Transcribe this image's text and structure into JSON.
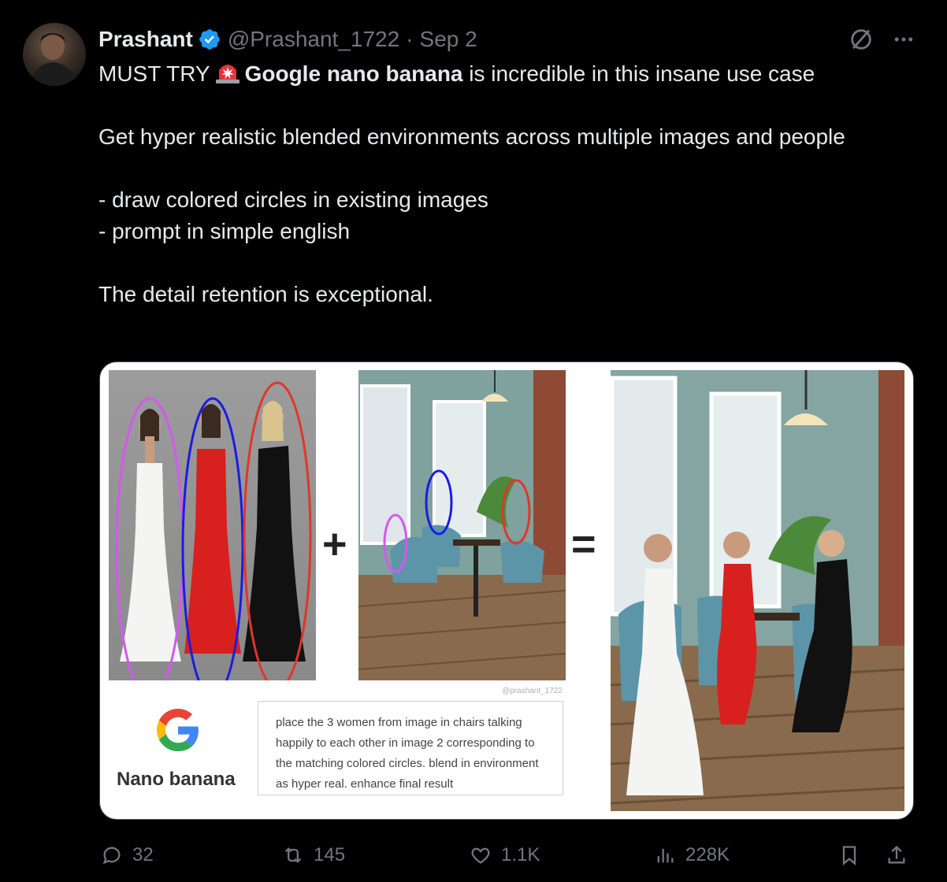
{
  "tweet": {
    "author_name": "Prashant",
    "handle": "@Prashant_1722",
    "separator": "·",
    "date": "Sep 2",
    "text_prefix": "MUST TRY",
    "text_bold": "Google nano banana",
    "text_suffix": " is incredible in this insane use case",
    "paragraph1": "Get hyper realistic blended environments across multiple images and people",
    "bullet1": "- draw colored circles in existing images",
    "bullet2": "- prompt in simple english",
    "closing": "The detail retention is exceptional."
  },
  "media": {
    "plus_sign": "+",
    "equals_sign": "=",
    "watermark": "@prashant_1722",
    "brand_label": "Nano banana",
    "prompt_text": "place the 3 women from image in chairs talking happily to each other in image 2 corresponding to the matching colored circles. blend in environment as hyper real. enhance final result",
    "circle_colors": [
      "#d657f0",
      "#1c1ce0",
      "#e0362c"
    ]
  },
  "actions": {
    "replies": "32",
    "reposts": "145",
    "likes": "1.1K",
    "views": "228K"
  },
  "colors": {
    "background": "#000000",
    "text": "#e7e9ea",
    "muted": "#71767b",
    "verified": "#1d9bf0"
  }
}
